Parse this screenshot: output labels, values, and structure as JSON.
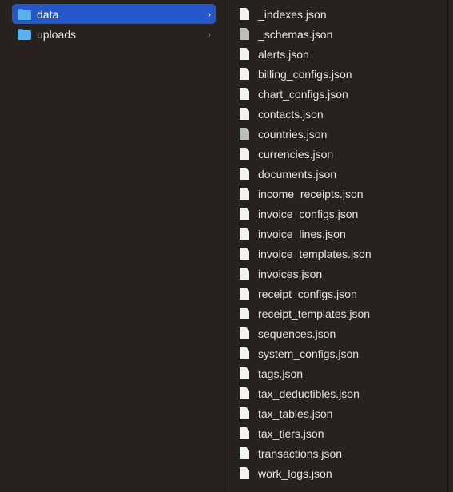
{
  "folders": [
    {
      "label": "data",
      "selected": true
    },
    {
      "label": "uploads",
      "selected": false
    }
  ],
  "files": [
    {
      "label": "_indexes.json",
      "grey": false
    },
    {
      "label": "_schemas.json",
      "grey": true
    },
    {
      "label": "alerts.json",
      "grey": false
    },
    {
      "label": "billing_configs.json",
      "grey": false
    },
    {
      "label": "chart_configs.json",
      "grey": false
    },
    {
      "label": "contacts.json",
      "grey": false
    },
    {
      "label": "countries.json",
      "grey": true
    },
    {
      "label": "currencies.json",
      "grey": false
    },
    {
      "label": "documents.json",
      "grey": false
    },
    {
      "label": "income_receipts.json",
      "grey": false
    },
    {
      "label": "invoice_configs.json",
      "grey": false
    },
    {
      "label": "invoice_lines.json",
      "grey": false
    },
    {
      "label": "invoice_templates.json",
      "grey": false
    },
    {
      "label": "invoices.json",
      "grey": false
    },
    {
      "label": "receipt_configs.json",
      "grey": false
    },
    {
      "label": "receipt_templates.json",
      "grey": false
    },
    {
      "label": "sequences.json",
      "grey": false
    },
    {
      "label": "system_configs.json",
      "grey": false
    },
    {
      "label": "tags.json",
      "grey": false
    },
    {
      "label": "tax_deductibles.json",
      "grey": false
    },
    {
      "label": "tax_tables.json",
      "grey": false
    },
    {
      "label": "tax_tiers.json",
      "grey": false
    },
    {
      "label": "transactions.json",
      "grey": false
    },
    {
      "label": "work_logs.json",
      "grey": false
    }
  ]
}
